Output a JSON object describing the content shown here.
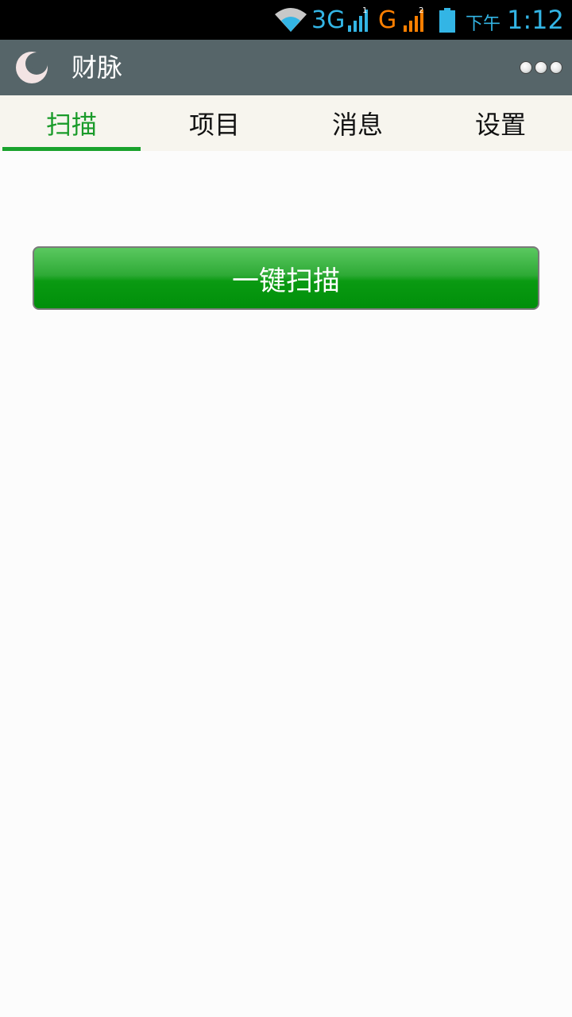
{
  "status_bar": {
    "network_type_1": "3G",
    "sim1_index": "1",
    "network_type_2": "G",
    "sim2_index": "2",
    "ampm": "下午",
    "time": "1:12",
    "colors": {
      "primary": "#33b5e5",
      "secondary": "#ff7f00"
    },
    "icons": [
      "wifi-icon",
      "signal-icon",
      "signal-icon",
      "battery-icon"
    ]
  },
  "action_bar": {
    "title": "财脉",
    "icons": [
      "app-logo-icon",
      "overflow-menu-icon"
    ]
  },
  "tabs": [
    {
      "label": "扫描",
      "active": true
    },
    {
      "label": "项目",
      "active": false
    },
    {
      "label": "消息",
      "active": false
    },
    {
      "label": "设置",
      "active": false
    }
  ],
  "main": {
    "scan_button_label": "一键扫描"
  },
  "colors": {
    "accent": "#1a9b2a",
    "action_bar": "#566569",
    "tab_bar": "#f7f5ee",
    "button_green": "#008f0a"
  }
}
